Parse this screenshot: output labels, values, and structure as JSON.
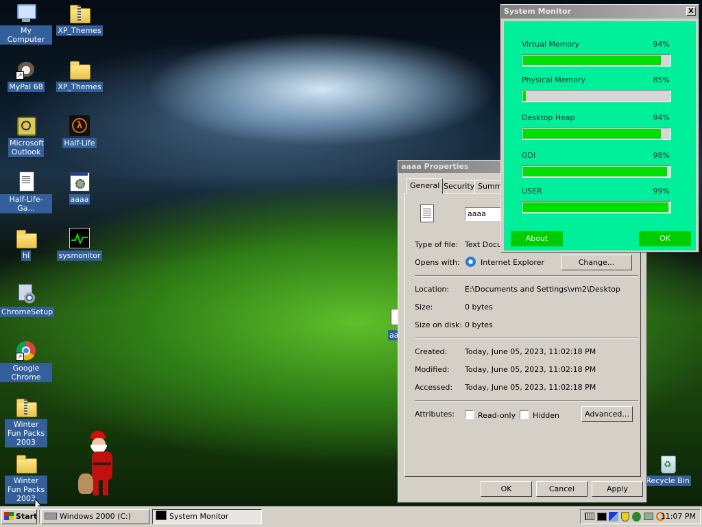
{
  "desktop": {
    "icons": [
      {
        "label": "My Computer"
      },
      {
        "label": "XP_Themes"
      },
      {
        "label": "MyPal 68"
      },
      {
        "label": "XP_Themes"
      },
      {
        "label": "Microsoft Outlook"
      },
      {
        "label": "Half-Life"
      },
      {
        "label": "Half-Life-Ga..."
      },
      {
        "label": "aaaa"
      },
      {
        "label": "hl"
      },
      {
        "label": "sysmonitor"
      },
      {
        "label": "ChromeSetup"
      },
      {
        "label": "Google Chrome"
      },
      {
        "label": "Winter Fun Packs 2003"
      },
      {
        "label": "Winter Fun Packs 2003"
      },
      {
        "label": "Recycle Bin"
      },
      {
        "label": "aa"
      }
    ]
  },
  "properties": {
    "title": "aaaa Properties",
    "tabs": [
      "General",
      "Security",
      "Summa"
    ],
    "name_value": "aaaa",
    "type_label": "Type of file:",
    "type_value": "Text Docum",
    "opens_label": "Opens with:",
    "opens_value": "Internet Explorer",
    "change_button": "Change...",
    "location_label": "Location:",
    "location_value": "E:\\Documents and Settings\\vm2\\Desktop",
    "size_label": "Size:",
    "size_value": "0 bytes",
    "sizeondisk_label": "Size on disk:",
    "sizeondisk_value": "0 bytes",
    "created_label": "Created:",
    "created_value": "Today, June 05, 2023, 11:02:18 PM",
    "modified_label": "Modified:",
    "modified_value": "Today, June 05, 2023, 11:02:18 PM",
    "accessed_label": "Accessed:",
    "accessed_value": "Today, June 05, 2023, 11:02:18 PM",
    "attributes_label": "Attributes:",
    "readonly_label": "Read-only",
    "hidden_label": "Hidden",
    "advanced_button": "Advanced...",
    "ok_button": "OK",
    "cancel_button": "Cancel",
    "apply_button": "Apply"
  },
  "sysmon": {
    "title": "System Monitor",
    "close_glyph": "X",
    "meters": [
      {
        "label": "Virtual Memory",
        "value": "94%",
        "fill": 0.94
      },
      {
        "label": "Physical Memory",
        "value": "85%",
        "fill": 0.02
      },
      {
        "label": "Desktop Heap",
        "value": "94%",
        "fill": 0.94
      },
      {
        "label": "GDI",
        "value": "98%",
        "fill": 0.98
      },
      {
        "label": "USER",
        "value": "99%",
        "fill": 0.99
      }
    ],
    "about_button": "About",
    "ok_button": "OK"
  },
  "taskbar": {
    "start_label": "Start",
    "items": [
      {
        "label": "Windows 2000 (C:)"
      },
      {
        "label": "System Monitor"
      }
    ],
    "clock": "11:07 PM"
  },
  "colors": {
    "sysmon_bg": "#00ef9a",
    "meter_fill": "#00e000",
    "button_green": "#00cc00"
  }
}
